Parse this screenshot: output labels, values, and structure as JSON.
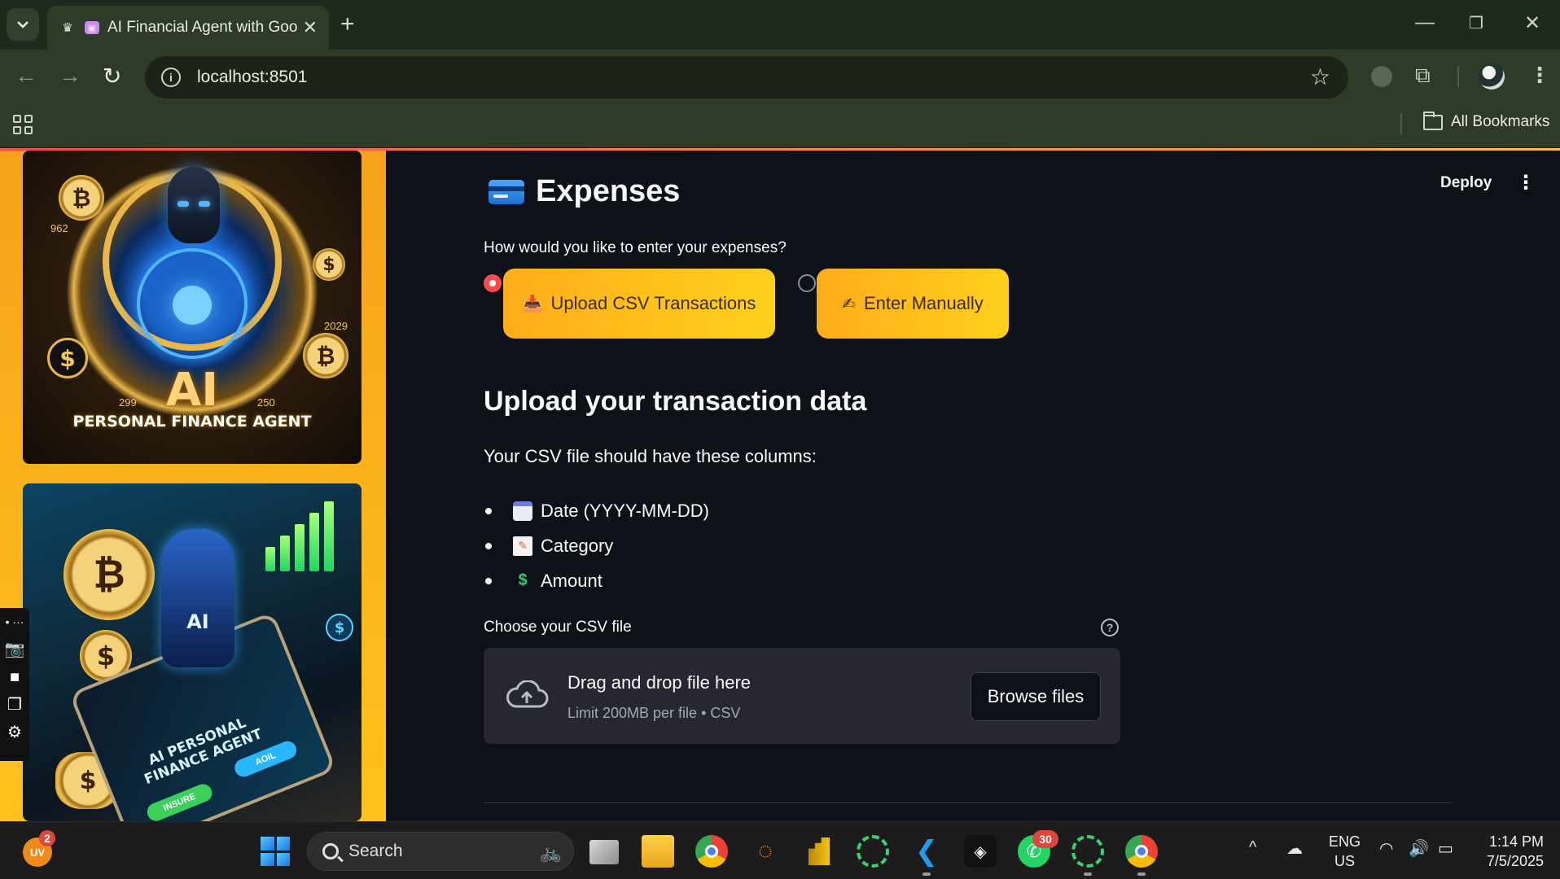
{
  "browser": {
    "tab_title": "AI Financial Agent with Goo",
    "url": "localhost:8501",
    "all_bookmarks": "All Bookmarks"
  },
  "sidebar": {
    "image1": {
      "big_text": "AI",
      "caption": "PERSONAL FINANCE AGENT",
      "numbers": [
        "962",
        "2029",
        "299",
        "250"
      ]
    },
    "image2": {
      "caption_line1": "AI PERSONAL",
      "caption_line2": "FINANCE AGENT",
      "chip1": "INSURE",
      "chip2": "AOIL",
      "robot_label": "AI"
    }
  },
  "header": {
    "deploy": "Deploy"
  },
  "page": {
    "title": "Expenses",
    "radio_prompt": "How would you like to enter your expenses?",
    "options": [
      {
        "label": "Upload CSV Transactions",
        "selected": true
      },
      {
        "label": "Enter Manually",
        "selected": false
      }
    ],
    "section_title": "Upload your transaction data",
    "columns_intro": "Your CSV file should have these columns:",
    "columns": [
      "Date (YYYY-MM-DD)",
      "Category",
      "Amount"
    ],
    "uploader": {
      "label": "Choose your CSV file",
      "drop_text": "Drag and drop file here",
      "limit_text": "Limit 200MB per file • CSV",
      "browse_label": "Browse files"
    }
  },
  "taskbar": {
    "user_initials": "UV",
    "user_badge": "2",
    "search_placeholder": "Search",
    "whatsapp_badge": "30",
    "lang_line1": "ENG",
    "lang_line2": "US",
    "time": "1:14 PM",
    "date": "7/5/2025"
  },
  "colors": {
    "accent": "#ff4b4b",
    "button_gradient_start": "#ffad1a",
    "button_gradient_end": "#ffd01c",
    "sidebar": "#ffc21c",
    "app_bg": "#0e1117"
  }
}
